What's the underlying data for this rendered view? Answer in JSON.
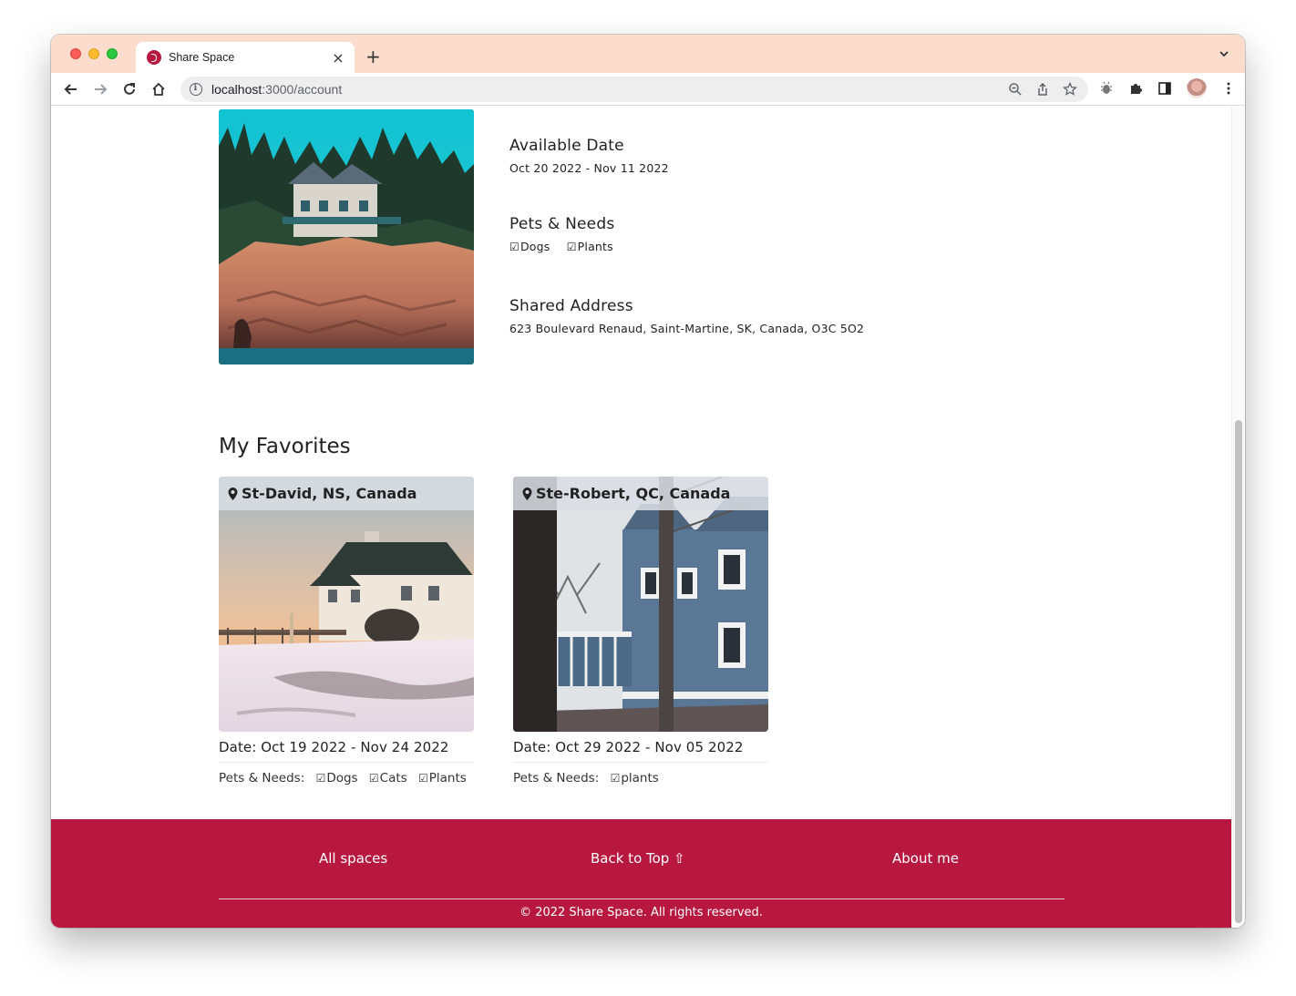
{
  "browser": {
    "tab_title": "Share Space",
    "tab_close": "×",
    "new_tab": "+",
    "url_host": "localhost",
    "url_path": ":3000/account"
  },
  "listing": {
    "available_heading": "Available Date",
    "available_value": "Oct 20 2022 - Nov 11 2022",
    "pets_heading": "Pets & Needs",
    "pets": [
      "Dogs",
      "Plants"
    ],
    "address_heading": "Shared Address",
    "address_value": "623 Boulevard Renaud, Saint-Martine, SK, Canada, O3C 5O2"
  },
  "favorites": {
    "title": "My Favorites",
    "cards": [
      {
        "location": "St-David, NS, Canada",
        "date": "Date: Oct 19 2022 - Nov 24 2022",
        "needs_label": "Pets & Needs:",
        "needs": [
          "Dogs",
          "Cats",
          "Plants"
        ]
      },
      {
        "location": "Ste-Robert, QC, Canada",
        "date": "Date: Oct 29 2022 - Nov 05 2022",
        "needs_label": "Pets & Needs:",
        "needs": [
          "plants"
        ]
      }
    ]
  },
  "footer": {
    "link_all": "All spaces",
    "link_top": "Back to Top ⇧",
    "link_about": "About me",
    "copyright": "© 2022 Share Space. All rights reserved."
  },
  "colors": {
    "brand": "#b81840",
    "tabbar": "#fcdccd"
  }
}
